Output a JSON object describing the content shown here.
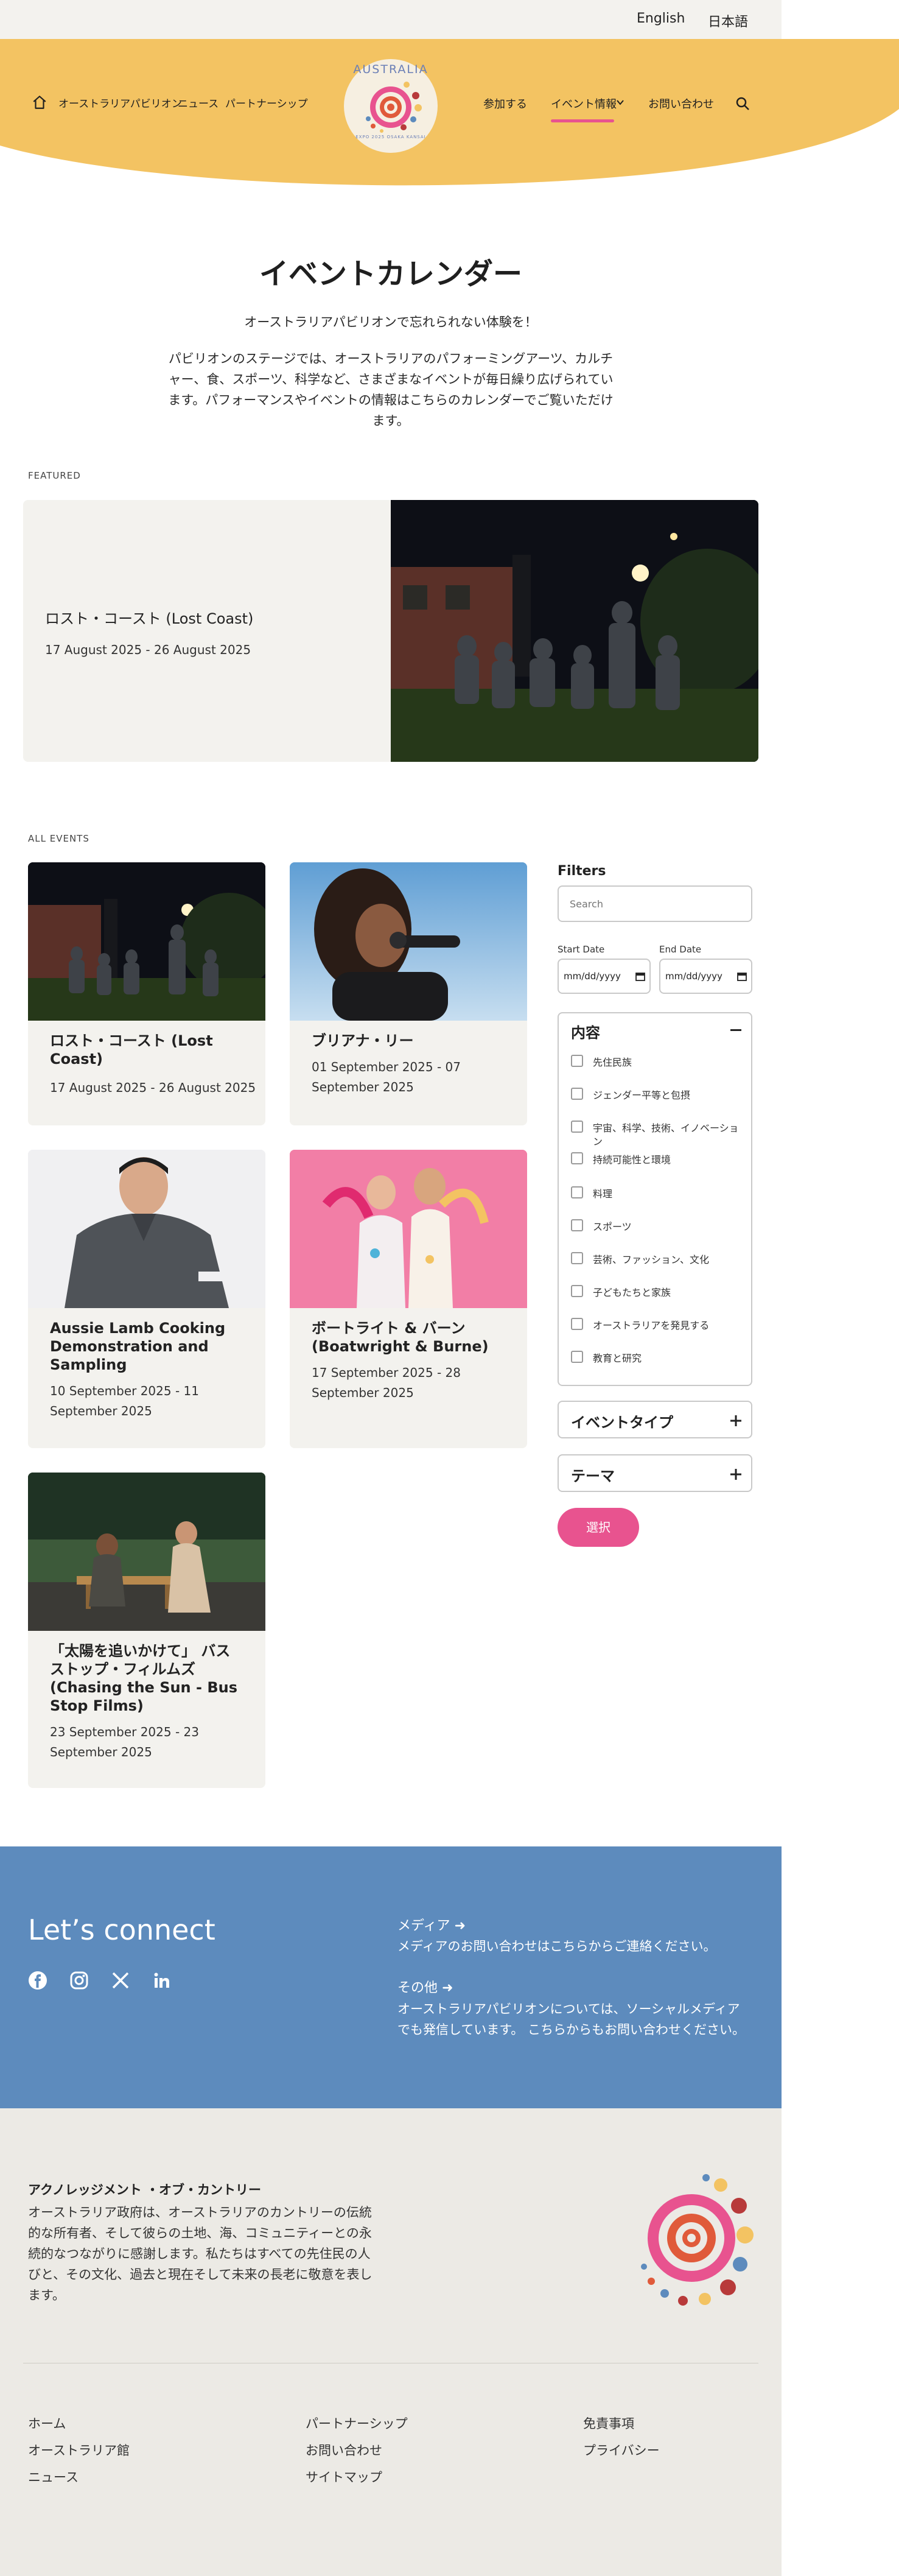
{
  "lang": {
    "english": "English",
    "japanese": "日本語"
  },
  "nav": {
    "left": [
      "オーストラリアパビリオン",
      "ニュース",
      "パートナーシップ"
    ],
    "right": [
      "参加する",
      "イベント情報",
      "お問い合わせ"
    ]
  },
  "logo_text": {
    "top": "AUSTRALIA",
    "bottom": "EXPO 2025 OSAKA KANSAI"
  },
  "page": {
    "title": "イベントカレンダー",
    "subtitle": "オーストラリアパビリオンで忘れられない体験を！",
    "intro_lines": [
      "パビリオンのステージでは、オーストラリアのパフォーミングアーツ、カルチ",
      "ャー、食、スポーツ、科学など、さまざまなイベントが毎日繰り広げられてい",
      "ます。パフォーマンスやイベントの情報はこちらのカレンダーでご覧いただけ",
      "ます。"
    ]
  },
  "featured": {
    "label": "FEATURED",
    "title": "ロスト・コースト (Lost Coast)",
    "date": "17 August 2025 - 26 August 2025"
  },
  "events": {
    "label": "ALL EVENTS",
    "items": [
      {
        "title_lines": [
          "ロスト・コースト (Lost",
          "Coast)"
        ],
        "date_lines": [
          "17 August 2025 - 26 August 2025"
        ]
      },
      {
        "title_lines": [
          "ブリアナ・リー"
        ],
        "date_lines": [
          "01 September 2025 - 07",
          "September 2025"
        ]
      },
      {
        "title_lines": [
          "Aussie Lamb Cooking",
          "Demonstration and",
          "Sampling"
        ],
        "date_lines": [
          "10 September 2025 - 11",
          "September 2025"
        ]
      },
      {
        "title_lines": [
          "ボートライト & バーン",
          "(Boatwright & Burne)"
        ],
        "date_lines": [
          "17 September 2025 - 28",
          "September 2025"
        ]
      },
      {
        "title_lines": [
          "「太陽を追いかけて」 バス",
          "ストップ・フィルムズ",
          "(Chasing the Sun - Bus",
          "Stop Films)"
        ],
        "date_lines": [
          "23 September 2025 - 23",
          "September 2025"
        ]
      }
    ]
  },
  "filters": {
    "title": "Filters",
    "search_placeholder": "Search",
    "start_label": "Start Date",
    "end_label": "End Date",
    "date_placeholder": "mm/dd/yyyy",
    "content": {
      "title": "内容",
      "options": [
        [
          "先住民族"
        ],
        [
          "ジェンダー平等と包摂"
        ],
        [
          "宇宙、科学、技術、イノベーショ",
          "ン"
        ],
        [
          "持続可能性と環境"
        ],
        [
          "料理"
        ],
        [
          "スポーツ"
        ],
        [
          "芸術、ファッション、文化"
        ],
        [
          "子どもたちと家族"
        ],
        [
          "オーストラリアを発見する"
        ],
        [
          "教育と研究"
        ]
      ]
    },
    "event_type": "イベントタイプ",
    "theme": "テーマ",
    "select_button": "選択"
  },
  "connect": {
    "title": "Let’s connect",
    "media_title": "メディア",
    "media_text": "メディアのお問い合わせはこちらからご連絡ください。",
    "other_title": "その他",
    "other_lines": [
      "オーストラリアパビリオンについては、ソーシャルメディア",
      "でも発信しています。 こちらからもお問い合わせください。"
    ]
  },
  "footer": {
    "ack_title": "アクノレッジメント ・オブ・カントリー",
    "ack_lines": [
      "オーストラリア政府は、オーストラリアのカントリーの伝統",
      "的な所有者、そして彼らの土地、海、コミュニティーとの永",
      "続的なつながりに感謝します。私たちはすべての先住民の人",
      "びと、その文化、過去と現在そして未来の長老に敬意を表し",
      "ます。"
    ],
    "col1": [
      "ホーム",
      "オーストラリア館",
      "ニュース"
    ],
    "col2": [
      "パートナーシップ",
      "お問い合わせ",
      "サイトマップ"
    ],
    "col3": [
      "免責事項",
      "プライバシー"
    ]
  },
  "colors": {
    "header": "#f3c362",
    "accent": "#e8538f",
    "connect": "#5d8bbd",
    "footer": "#eceae5"
  }
}
